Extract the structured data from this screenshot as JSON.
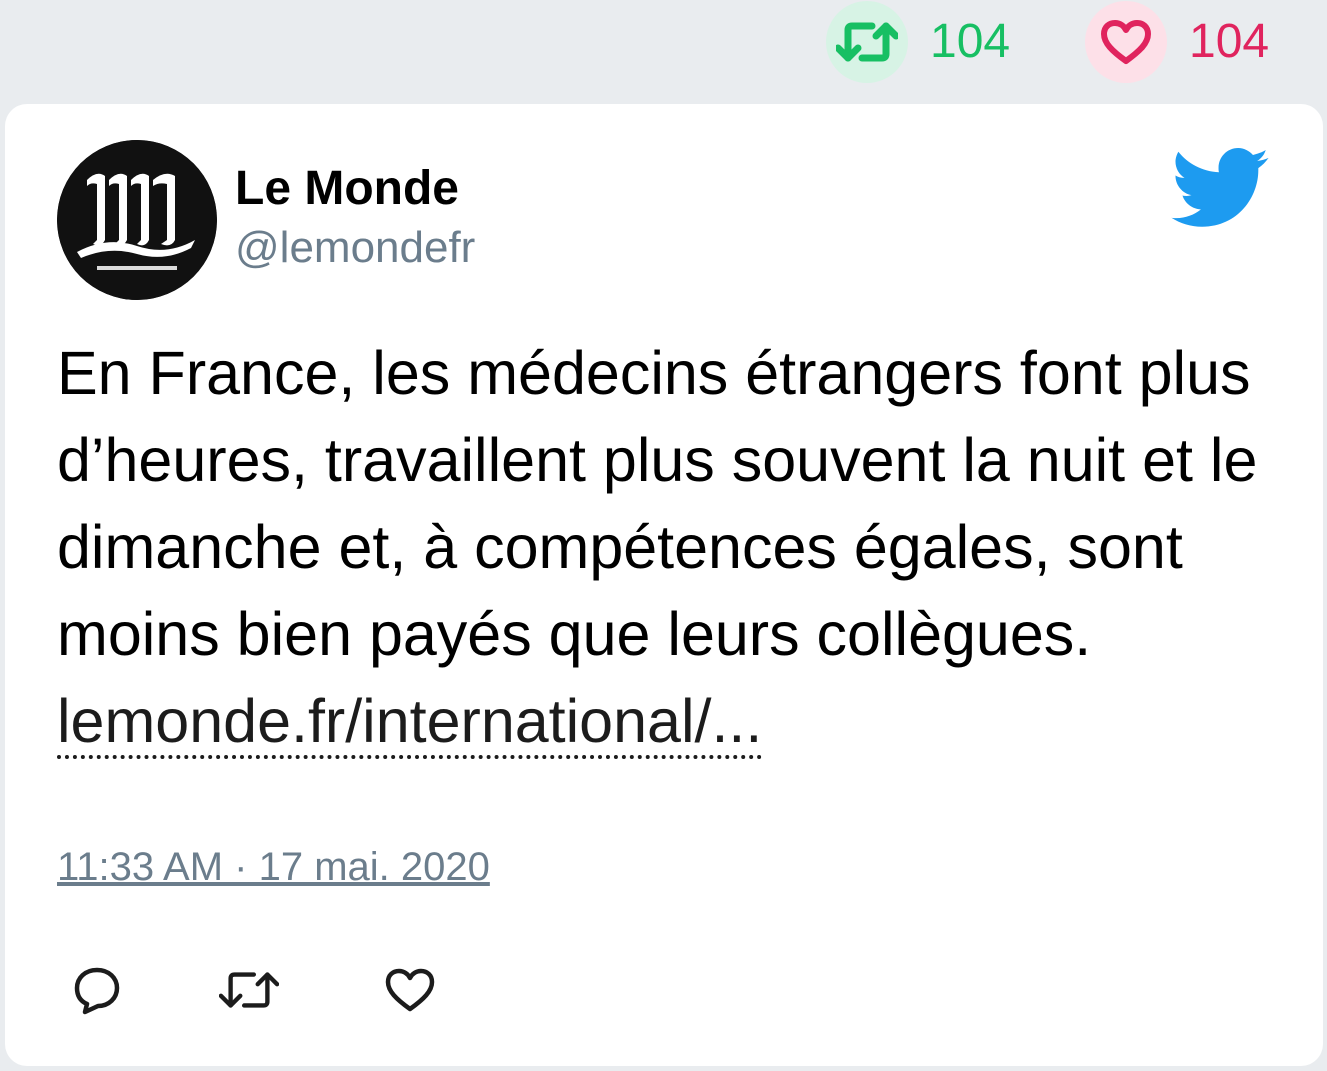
{
  "top_stats": {
    "retweet_count": "104",
    "like_count": "104"
  },
  "tweet": {
    "author_name": "Le Monde",
    "author_handle": "@lemondefr",
    "text": "En France, les médecins étrangers font plus d’heures, travaillent plus souvent la nuit et le dimanche et, à compétences égales, sont moins bien payés que leurs collègues. ",
    "link_text": "lemonde.fr/international/...",
    "timestamp": "11:33 AM · 17 mai. 2020"
  },
  "colors": {
    "retweet_green": "#17bf63",
    "like_red": "#e0245e",
    "twitter_blue": "#1d9bf0",
    "handle_gray": "#6b7d8c"
  },
  "icons": {
    "retweet": "retweet-icon",
    "like": "heart-icon",
    "reply": "reply-icon",
    "brand": "twitter-bird-icon",
    "avatar": "le-monde-logo"
  }
}
